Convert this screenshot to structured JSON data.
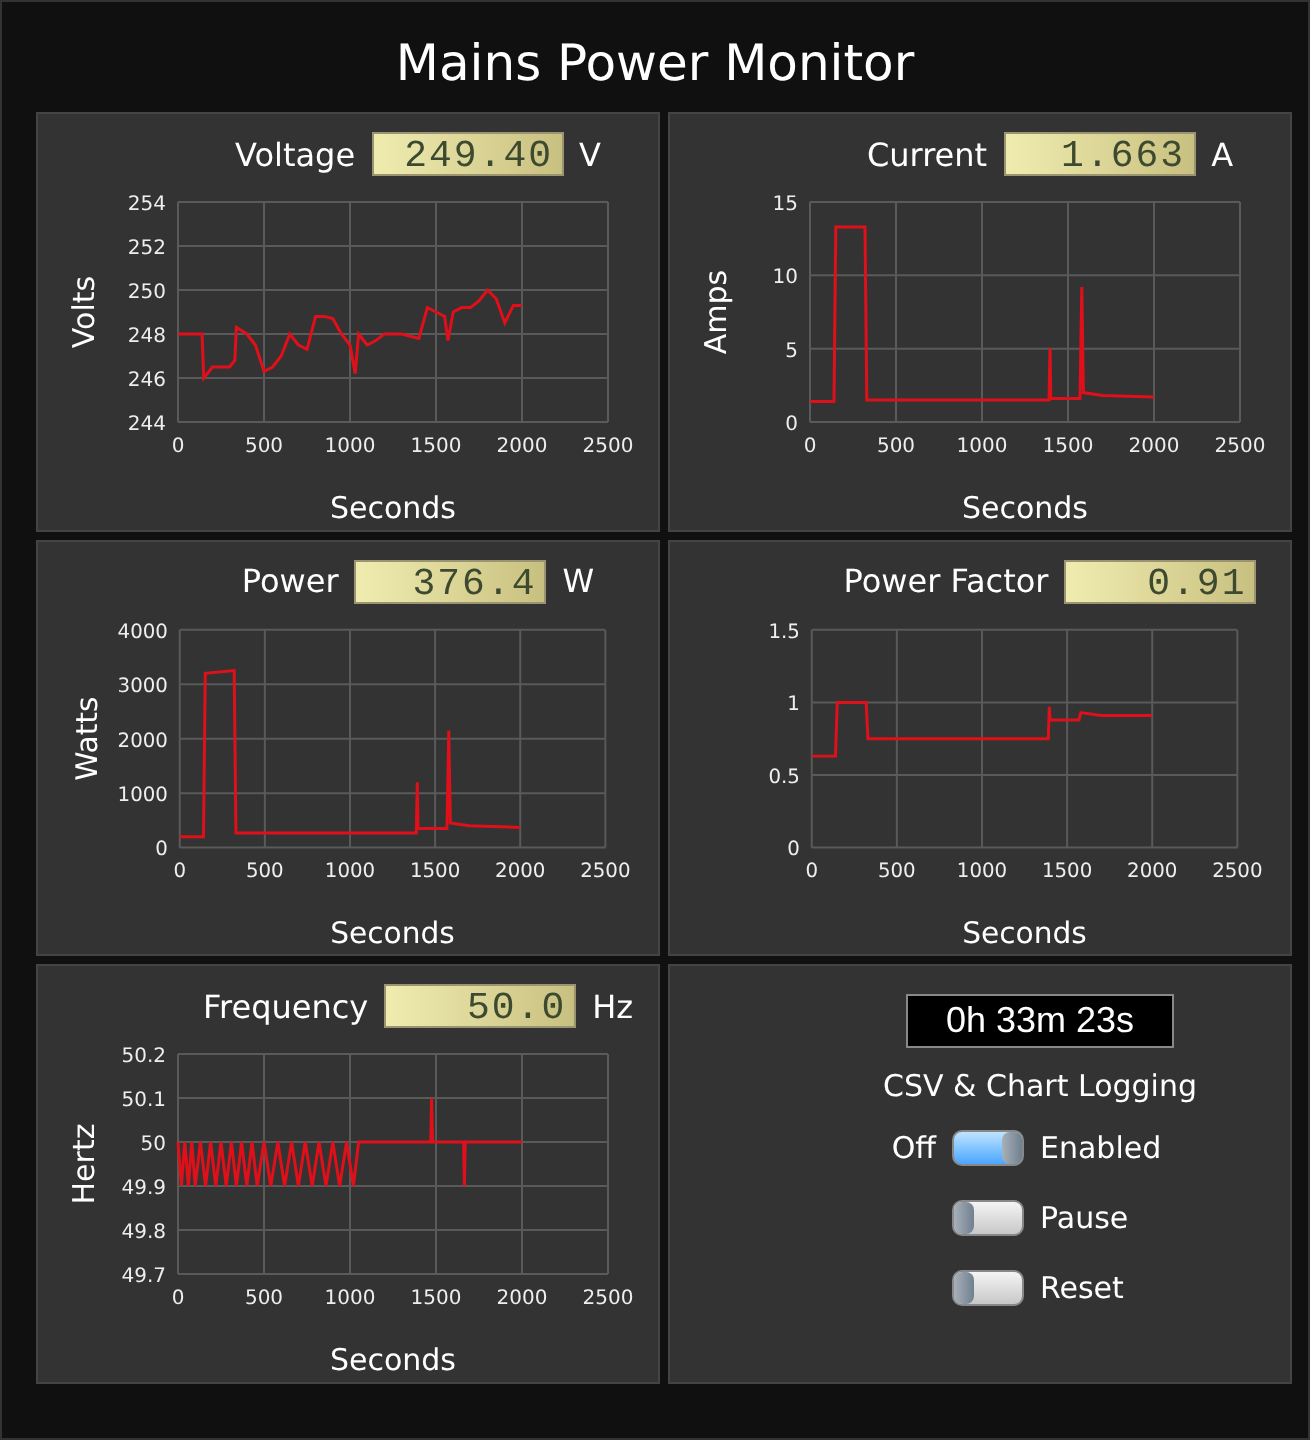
{
  "window": {
    "title": "Mains Power Monitor"
  },
  "panels": [
    {
      "title": "Voltage",
      "reading": "249.40",
      "unit": "V",
      "chart_data": {
        "type": "line",
        "xlabel": "Seconds",
        "ylabel": "Volts",
        "x": [
          0,
          50,
          100,
          140,
          150,
          200,
          250,
          300,
          330,
          340,
          400,
          450,
          500,
          550,
          600,
          650,
          700,
          750,
          800,
          850,
          900,
          950,
          1000,
          1030,
          1050,
          1100,
          1150,
          1200,
          1300,
          1400,
          1450,
          1500,
          1550,
          1570,
          1600,
          1650,
          1700,
          1750,
          1800,
          1850,
          1900,
          1950,
          2000
        ],
        "series": [
          {
            "color": "#e0101a",
            "values": [
              248,
              248,
              248,
              248,
              246,
              246.5,
              246.5,
              246.5,
              246.8,
              248.3,
              248,
              247.5,
              246.3,
              246.5,
              247,
              248,
              247.5,
              247.3,
              248.8,
              248.8,
              248.7,
              248,
              247.5,
              246.2,
              248,
              247.5,
              247.7,
              248,
              248,
              247.8,
              249.2,
              249,
              248.8,
              247.7,
              249,
              249.2,
              249.2,
              249.5,
              250,
              249.6,
              248.5,
              249.3,
              249.3
            ]
          }
        ],
        "xlim": [
          0,
          2500
        ],
        "ylim": [
          244,
          254
        ],
        "xticks": [
          0,
          500,
          1000,
          1500,
          2000,
          2500
        ],
        "yticks": [
          244,
          246,
          248,
          250,
          252,
          254
        ],
        "grid": true
      }
    },
    {
      "title": "Current",
      "reading": "1.663",
      "unit": "A",
      "chart_data": {
        "type": "line",
        "xlabel": "Seconds",
        "ylabel": "Amps",
        "x": [
          0,
          140,
          150,
          320,
          330,
          500,
          1000,
          1390,
          1395,
          1400,
          1570,
          1580,
          1590,
          1700,
          2000
        ],
        "series": [
          {
            "color": "#e0101a",
            "values": [
              1.4,
              1.4,
              13.3,
              13.3,
              1.5,
              1.5,
              1.5,
              1.5,
              5,
              1.6,
              1.6,
              9.2,
              2,
              1.8,
              1.7
            ]
          }
        ],
        "xlim": [
          0,
          2500
        ],
        "ylim": [
          0,
          15
        ],
        "xticks": [
          0,
          500,
          1000,
          1500,
          2000,
          2500
        ],
        "yticks": [
          0,
          5,
          10,
          15
        ],
        "grid": true
      }
    },
    {
      "title": "Power",
      "reading": "376.4",
      "unit": "W",
      "chart_data": {
        "type": "line",
        "xlabel": "Seconds",
        "ylabel": "Watts",
        "x": [
          0,
          140,
          150,
          320,
          330,
          500,
          1000,
          1390,
          1395,
          1400,
          1570,
          1580,
          1590,
          1700,
          2000
        ],
        "series": [
          {
            "color": "#e0101a",
            "values": [
              200,
              200,
              3200,
              3250,
              270,
              270,
              270,
              270,
              1200,
              350,
              350,
              2150,
              450,
              400,
              370
            ]
          }
        ],
        "xlim": [
          0,
          2500
        ],
        "ylim": [
          0,
          4000
        ],
        "xticks": [
          0,
          500,
          1000,
          1500,
          2000,
          2500
        ],
        "yticks": [
          0,
          1000,
          2000,
          3000,
          4000
        ],
        "grid": true
      }
    },
    {
      "title": "Power Factor",
      "reading": "0.91",
      "chart_data": {
        "type": "line",
        "x": [
          0,
          140,
          150,
          320,
          330,
          1000,
          1390,
          1395,
          1400,
          1570,
          1580,
          1700,
          2000
        ],
        "xlabel": "Seconds",
        "series": [
          {
            "color": "#e0101a",
            "values": [
              0.63,
              0.63,
              1,
              1,
              0.75,
              0.75,
              0.75,
              0.97,
              0.88,
              0.88,
              0.93,
              0.91,
              0.91
            ]
          }
        ],
        "xlim": [
          0,
          2500
        ],
        "ylim": [
          0,
          1.5
        ],
        "xticks": [
          0,
          500,
          1000,
          1500,
          2000,
          2500
        ],
        "yticks": [
          0,
          0.5,
          1,
          1.5
        ],
        "grid": true
      }
    },
    {
      "title": "Frequency",
      "reading": "50.0",
      "unit": "Hz",
      "chart_data": {
        "type": "line",
        "xlabel": "Seconds",
        "ylabel": "Hertz",
        "x": [
          0,
          20,
          40,
          60,
          80,
          100,
          130,
          160,
          190,
          220,
          250,
          280,
          310,
          340,
          370,
          400,
          430,
          460,
          500,
          540,
          580,
          620,
          660,
          700,
          740,
          780,
          820,
          860,
          900,
          940,
          980,
          1020,
          1050,
          1060,
          1470,
          1475,
          1480,
          1660,
          1665,
          1670,
          2000
        ],
        "series": [
          {
            "color": "#e0101a",
            "values": [
              50,
              49.9,
              50,
              49.9,
              50,
              49.9,
              50,
              49.9,
              50,
              49.9,
              50,
              49.9,
              50,
              49.9,
              50,
              49.9,
              50,
              49.9,
              50,
              49.9,
              50,
              49.9,
              50,
              49.9,
              50,
              49.9,
              50,
              49.9,
              50,
              49.9,
              50,
              49.9,
              50,
              50,
              50,
              50.1,
              50,
              50,
              49.9,
              50,
              50
            ]
          }
        ],
        "xlim": [
          0,
          2500
        ],
        "ylim": [
          49.7,
          50.2
        ],
        "xticks": [
          0,
          500,
          1000,
          1500,
          2000,
          2500
        ],
        "yticks": [
          49.7,
          49.8,
          49.9,
          50,
          50.1,
          50.2
        ],
        "grid": true
      }
    }
  ],
  "logging": {
    "timer": "0h 33m 23s",
    "title": "CSV & Chart Logging",
    "toggles": [
      {
        "off_label": "Off",
        "label": "Enabled",
        "on": true
      },
      {
        "label": "Pause",
        "on": false
      },
      {
        "label": "Reset",
        "on": false
      }
    ]
  }
}
